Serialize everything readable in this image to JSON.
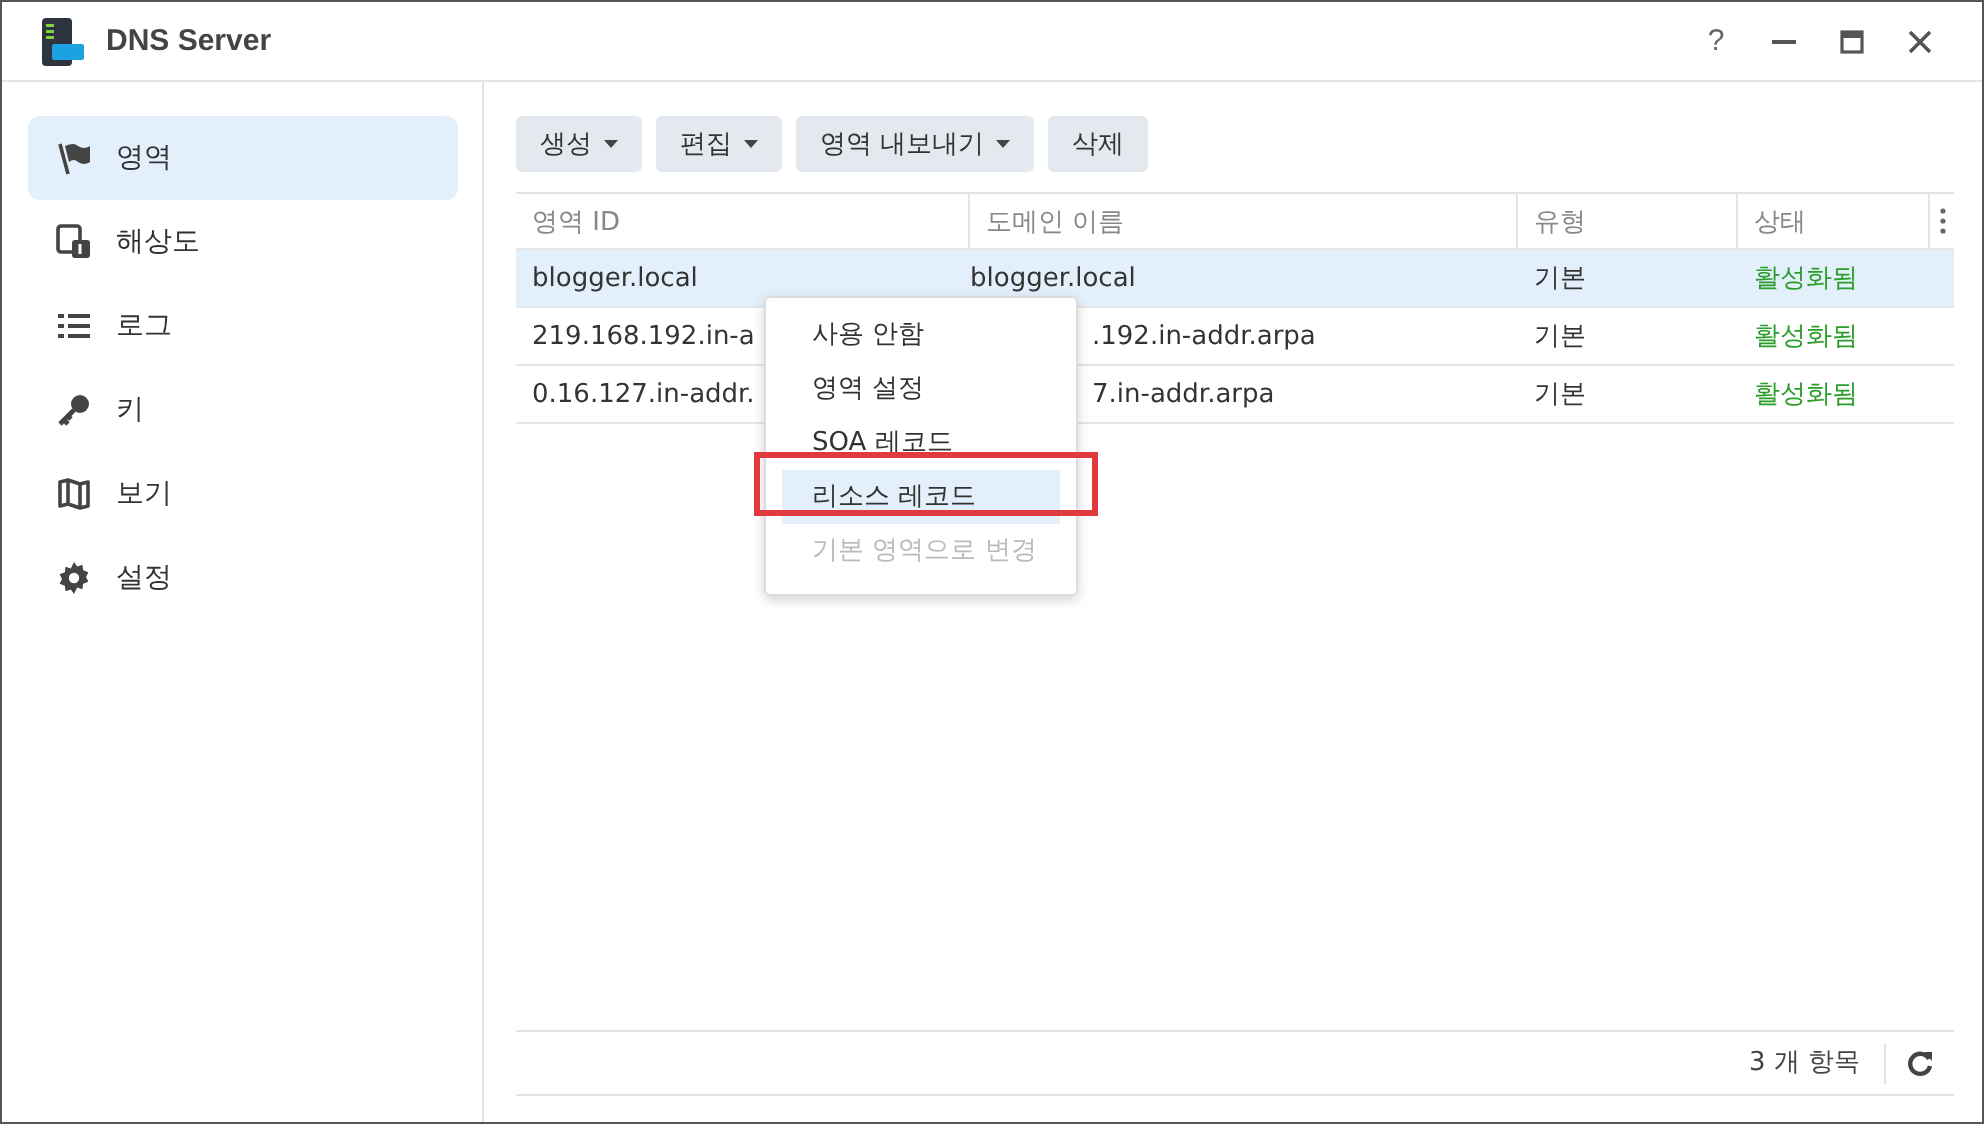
{
  "window": {
    "title": "DNS Server",
    "controls": [
      "?"
    ]
  },
  "sidebar": {
    "items": [
      {
        "label": "영역",
        "selected": true
      },
      {
        "label": "해상도",
        "selected": false
      },
      {
        "label": "로그",
        "selected": false
      },
      {
        "label": "키",
        "selected": false
      },
      {
        "label": "보기",
        "selected": false
      },
      {
        "label": "설정",
        "selected": false
      }
    ]
  },
  "toolbar": [
    {
      "label": "생성",
      "dropdown": true
    },
    {
      "label": "편집",
      "dropdown": true
    },
    {
      "label": "영역 내보내기",
      "dropdown": true
    },
    {
      "label": "삭제",
      "dropdown": false
    }
  ],
  "table": {
    "columns": [
      "영역 ID",
      "도메인 이름",
      "유형",
      "상태"
    ],
    "rows": [
      {
        "selected": true,
        "cells": [
          "blogger.local",
          "blogger.local",
          "기본",
          "활성화됨"
        ]
      },
      {
        "selected": false,
        "cells": [
          "219.168.192.in-a",
          ".192.in-addr.arpa",
          "기본",
          "활성화됨"
        ]
      },
      {
        "selected": false,
        "cells": [
          "0.16.127.in-addr.",
          "7.in-addr.arpa",
          "기본",
          "활성화됨"
        ]
      }
    ]
  },
  "context_menu": {
    "items": [
      {
        "label": "사용 안함",
        "highlighted": false,
        "disabled": false
      },
      {
        "label": "영역 설정",
        "highlighted": false,
        "disabled": false
      },
      {
        "label": "SOA 레코드",
        "highlighted": false,
        "disabled": false
      },
      {
        "label": "리소스 레코드",
        "highlighted": true,
        "disabled": false
      },
      {
        "label": "기본 영역으로 변경",
        "highlighted": false,
        "disabled": true
      }
    ]
  },
  "footer": {
    "count": "3 개 항목"
  }
}
